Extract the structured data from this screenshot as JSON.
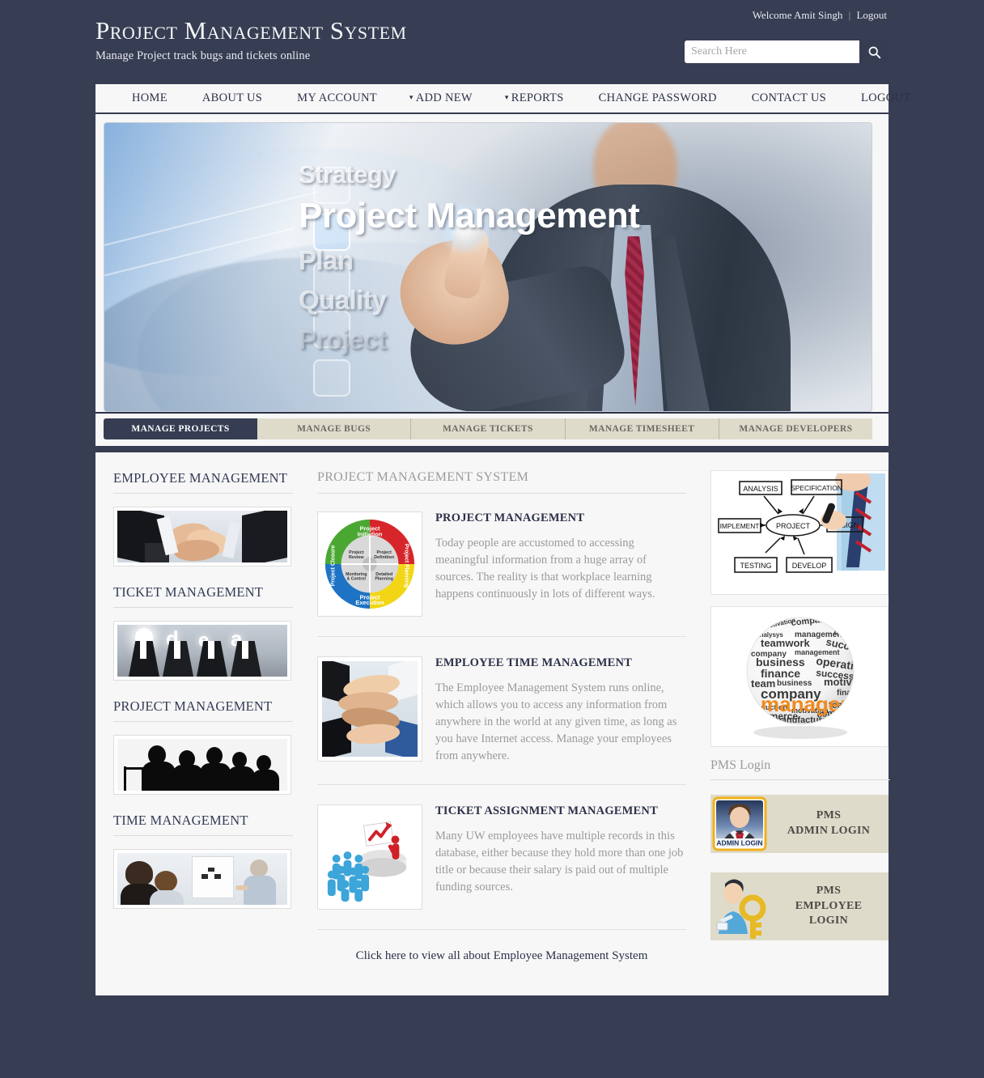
{
  "header": {
    "title": "Project Management System",
    "subtitle": "Manage Project track bugs and tickets online",
    "welcome": "Welcome Amit Singh",
    "separator": "|",
    "logout": "Logout",
    "search_placeholder": "Search Here",
    "search_value": "",
    "search_icon": "search-icon"
  },
  "nav": {
    "items": [
      {
        "label": "Home",
        "caret": ""
      },
      {
        "label": "About Us",
        "caret": ""
      },
      {
        "label": "My Account",
        "caret": ""
      },
      {
        "label": "Add New",
        "caret": "▾"
      },
      {
        "label": "Reports",
        "caret": "▾"
      },
      {
        "label": "Change Password",
        "caret": ""
      },
      {
        "label": "Contact Us",
        "caret": ""
      },
      {
        "label": "Logout",
        "caret": ""
      }
    ]
  },
  "banner": {
    "words": [
      "Strategy",
      "Project Management",
      "Plan",
      "Quality",
      "Project"
    ],
    "alt": "businessman touching project management interface"
  },
  "tabs": [
    {
      "label": "Manage Projects",
      "active": true
    },
    {
      "label": "Manage Bugs",
      "active": false
    },
    {
      "label": "Manage Tickets",
      "active": false
    },
    {
      "label": "Manage Timesheet",
      "active": false
    },
    {
      "label": "Manage Developers",
      "active": false
    }
  ],
  "sidebar_left": {
    "sections": [
      {
        "heading": "Employee Management",
        "image": "team-handshake-photo"
      },
      {
        "heading": "Ticket Management",
        "image": "idea-businessmen-photo"
      },
      {
        "heading": "Project Management",
        "image": "meeting-silhouette-photo"
      },
      {
        "heading": "Time Management",
        "image": "presentation-photo"
      }
    ]
  },
  "main": {
    "heading": "Project Management System",
    "articles": [
      {
        "title": "Project Management",
        "text": "Today people are accustomed to accessing meaningful information from a huge array of sources. The reality is that workplace learning happens continuously in lots of different ways.",
        "image": "project-lifecycle-wheel",
        "wheel_labels": [
          "Project Initiation",
          "Project Planning",
          "Project Execution",
          "Project Closure",
          "Project Review",
          "Project Definition",
          "Monitoring & Control",
          "Detailed Planning"
        ]
      },
      {
        "title": "Employee Time Management",
        "text": "The Employee Management System runs online, which allows you to access any information from anywhere in the world at any given time, as long as you have Internet access. Manage your employees from anywhere.",
        "image": "stacked-hands-photo"
      },
      {
        "title": "Ticket Assignment Management",
        "text": "Many UW employees have multiple records in this database, either because they hold more than one job title or because their salary is paid out of multiple funding sources.",
        "image": "crowd-leader-3d-graphic"
      }
    ],
    "cta": "Click here to view all about Employee Management System"
  },
  "sidebar_right": {
    "images": [
      {
        "name": "project-flow-whiteboard",
        "labels": [
          "ANALYSIS",
          "SPECIFICATION",
          "IMPLEMENT",
          "PROJECT",
          "DESIGN",
          "TESTING",
          "DEVELOP"
        ]
      },
      {
        "name": "management-word-globe",
        "main_word": "management"
      }
    ],
    "login_heading": "PMS Login",
    "logins": [
      {
        "label": "PMS\nADMIN LOGIN",
        "line1": "PMS",
        "line2": "ADMIN LOGIN",
        "line3": "",
        "icon": "admin-avatar-icon",
        "badge": "ADMIN LOGIN"
      },
      {
        "label": "PMS EMPLOYEE LOGIN",
        "line1": "PMS",
        "line2": "EMPLOYEE",
        "line3": "LOGIN",
        "icon": "employee-key-icon",
        "badge": ""
      }
    ]
  },
  "colors": {
    "page_background": "#373d52",
    "content_background": "#f7f7f7",
    "accent_navy": "#363c52",
    "tab_beige": "#dedbcb",
    "muted_text": "#9a9a9a"
  }
}
